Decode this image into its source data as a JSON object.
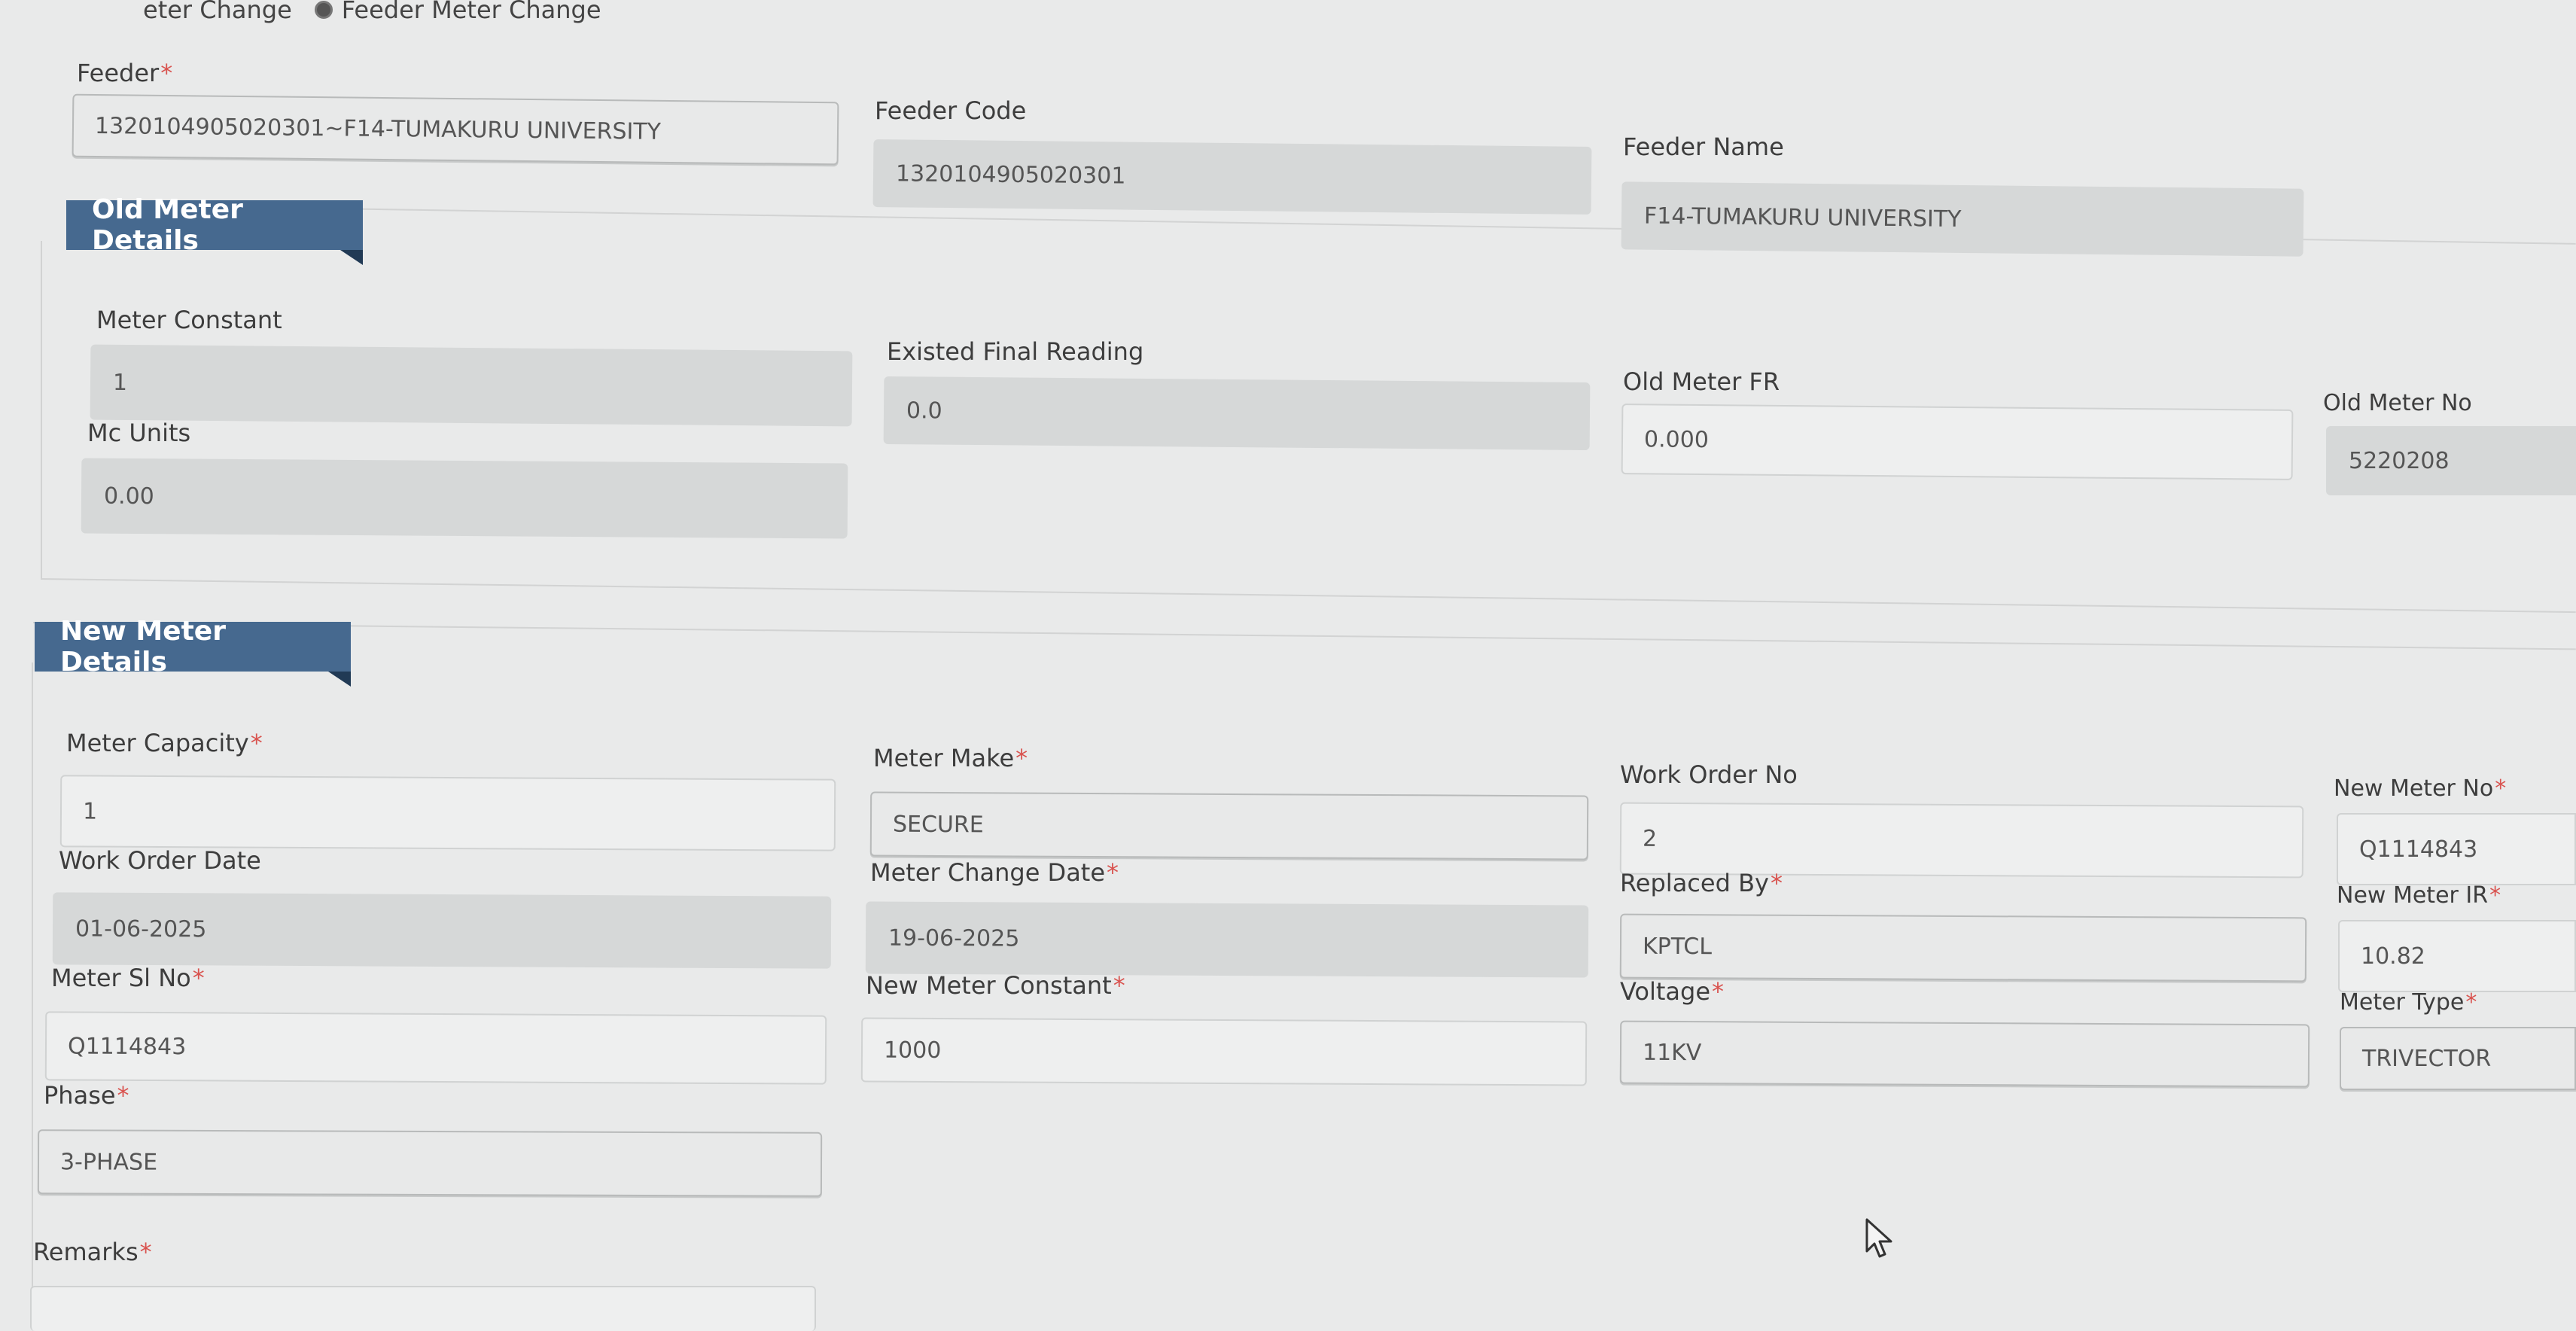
{
  "header": {
    "radio_partial_label": "eter Change",
    "radio_feeder_label": "Feeder Meter Change"
  },
  "feeder": {
    "feeder_label": "Feeder",
    "feeder_value": "1320104905020301~F14-TUMAKURU UNIVERSITY",
    "feeder_code_label": "Feeder Code",
    "feeder_code_value": "1320104905020301",
    "feeder_name_label": "Feeder Name",
    "feeder_name_value": "F14-TUMAKURU UNIVERSITY"
  },
  "old_meter": {
    "title": "Old Meter Details",
    "meter_constant_label": "Meter Constant",
    "meter_constant_value": "1",
    "existed_final_reading_label": "Existed Final Reading",
    "existed_final_reading_value": "0.0",
    "old_meter_fr_label": "Old Meter FR",
    "old_meter_fr_value": "0.000",
    "old_meter_no_label": "Old Meter No",
    "old_meter_no_value": "5220208",
    "mc_units_label": "Mc Units",
    "mc_units_value": "0.00"
  },
  "new_meter": {
    "title": "New Meter Details",
    "meter_capacity_label": "Meter Capacity",
    "meter_capacity_value": "1",
    "meter_make_label": "Meter Make",
    "meter_make_value": "SECURE",
    "work_order_no_label": "Work Order No",
    "work_order_no_value": "2",
    "new_meter_no_label": "New Meter No",
    "new_meter_no_value": "Q1114843",
    "work_order_date_label": "Work Order Date",
    "work_order_date_value": "01-06-2025",
    "meter_change_date_label": "Meter Change Date",
    "meter_change_date_value": "19-06-2025",
    "replaced_by_label": "Replaced By",
    "replaced_by_value": "KPTCL",
    "new_meter_ir_label": "New Meter IR",
    "new_meter_ir_value": "10.82",
    "meter_sl_no_label": "Meter Sl No",
    "meter_sl_no_value": "Q1114843",
    "new_meter_constant_label": "New Meter Constant",
    "new_meter_constant_value": "1000",
    "voltage_label": "Voltage",
    "voltage_value": "11KV",
    "meter_type_label": "Meter Type",
    "meter_type_value": "TRIVECTOR",
    "phase_label": "Phase",
    "phase_value": "3-PHASE",
    "remarks_label": "Remarks"
  },
  "required_mark": "*"
}
